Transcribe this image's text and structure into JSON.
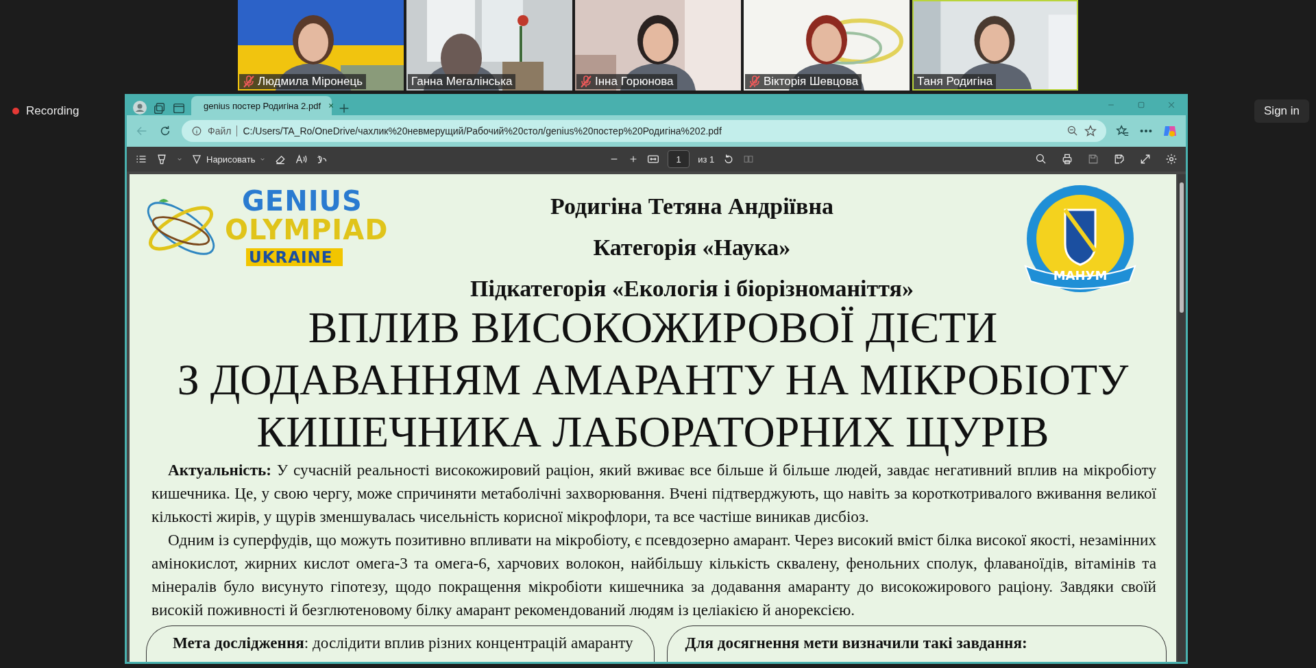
{
  "recording": {
    "label": "Recording"
  },
  "sign_in": "Sign in",
  "participants": [
    {
      "name": "Людмила Міронець",
      "muted": true,
      "speaking": false
    },
    {
      "name": "Ганна Мегалінська",
      "muted": false,
      "speaking": false
    },
    {
      "name": "Інна Горюнова",
      "muted": true,
      "speaking": false
    },
    {
      "name": "Вікторія Шевцова",
      "muted": true,
      "speaking": false
    },
    {
      "name": "Таня Родигіна",
      "muted": false,
      "speaking": true
    }
  ],
  "browser": {
    "tabs": [
      {
        "title": "genius постер Родигіна 2.pdf",
        "selected": true
      }
    ],
    "address": {
      "scheme_label": "Файл",
      "url": "C:/Users/TA_Ro/OneDrive/чахлик%20невмерущий/Рабочий%20стол/genius%20постер%20Родигіна%202.pdf"
    }
  },
  "pdf_toolbar": {
    "draw_label": "Нарисовать",
    "page": "1",
    "page_count": "из 1"
  },
  "poster": {
    "logo": {
      "line_1": "GENIUS",
      "line_2": "OLYMPIAD",
      "line_3": "UKRAINE"
    },
    "emblem": {
      "label": "МАНУМ"
    },
    "author": "Родигіна Тетяна Андріївна",
    "category": "Категорія «Наука»",
    "subcategory": "Підкатегорія «Екологія і біорізноманіття»",
    "title_lines": [
      "ВПЛИВ ВИСОКОЖИРОВОЇ ДІЄТИ",
      "З ДОДАВАННЯМ АМАРАНТУ НА МІКРОБІОТУ",
      "КИШЕЧНИКА ЛАБОРАТОРНИХ ЩУРІВ"
    ],
    "paragraphs": [
      "**Актуальність:** У сучасній реальності  високожировий раціон, який вживає все більше й більше людей, завдає негативний вплив на мікробіоту кишечника. Це, у свою чергу, може спричиняти метаболічні захворювання. Вчені підтверджують, що навіть за короткотривалого вживання великої кількості жирів, у щурів зменшувалась чисельність корисної мікрофлори, та все частіше виникав дисбіоз.",
      "Одним із суперфудів, що можуть позитивно впливати на мікробіоту, є псевдозерно амарант. Через високий вміст білка високої якості, незамінних амінокислот, жирних кислот омега-3 та омега-6, харчових волокон, найбільшу кількість сквалену, фенольних сполук, флаваноїдів, вітамінів та мінералів було висунуто гіпотезу, щодо покращення мікробіоти кишечника за додавання амаранту до високожирового раціону. Завдяки своїй високій поживності й безглютеновому білку амарант рекомендований людям із целіакією й анорексією."
    ],
    "aim": "**Мета дослідження**: дослідити вплив різних концентрацій амаранту",
    "tasks": {
      "heading": "Для досягнення мети визначили такі завдання:"
    }
  }
}
